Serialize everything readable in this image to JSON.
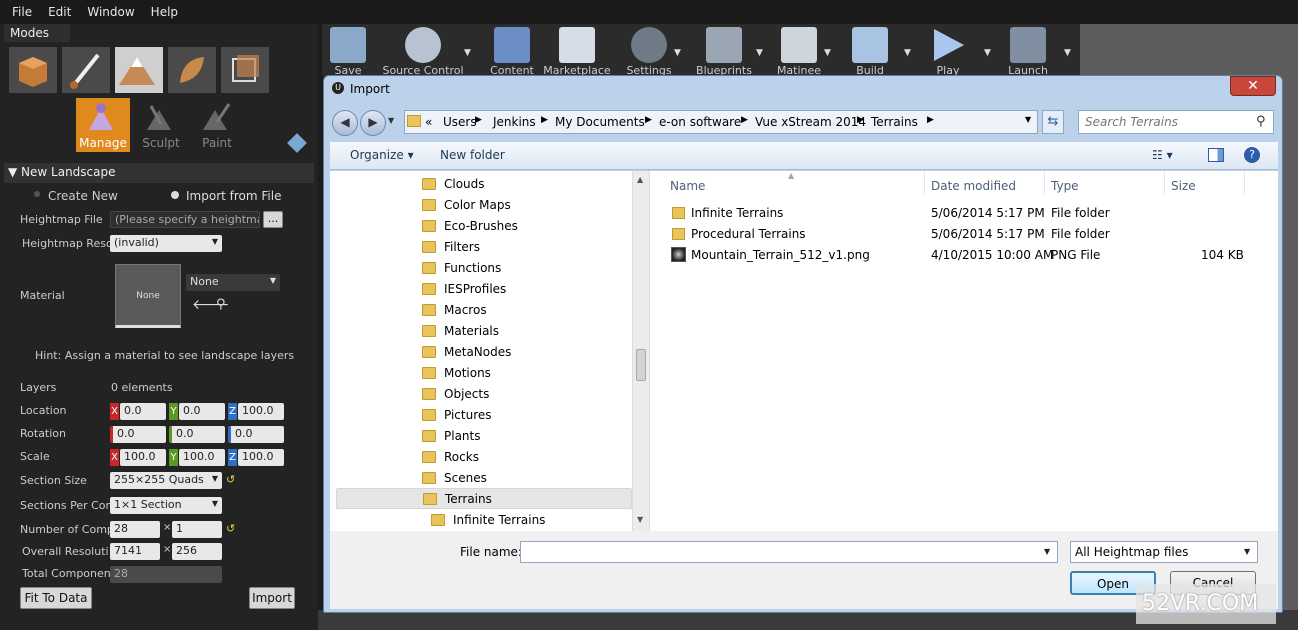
{
  "menu": [
    "File",
    "Edit",
    "Window",
    "Help"
  ],
  "modes": {
    "tab": "Modes",
    "tools": [
      {
        "label": "Manage",
        "active": true
      },
      {
        "label": "Sculpt",
        "active": false
      },
      {
        "label": "Paint",
        "active": false
      }
    ]
  },
  "landscape": {
    "section_title": "New Landscape",
    "create_new": "Create New",
    "import_from_file": "Import from File",
    "heightmap_file_label": "Heightmap File",
    "heightmap_file_placeholder": "(Please specify a heightmap",
    "browse": "...",
    "heightmap_res_label": "Heightmap Reso",
    "heightmap_res_value": "(invalid)",
    "material_label": "Material",
    "material_thumb": "None",
    "material_value": "None",
    "hint": "Hint: Assign a material to see landscape layers",
    "layers_label": "Layers",
    "layers_value": "0 elements",
    "location_label": "Location",
    "location": [
      "0.0",
      "0.0",
      "100.0"
    ],
    "rotation_label": "Rotation",
    "rotation": [
      "0.0",
      "0.0",
      "0.0"
    ],
    "scale_label": "Scale",
    "scale": [
      "100.0",
      "100.0",
      "100.0"
    ],
    "axes": [
      "X",
      "Y",
      "Z"
    ],
    "section_size_label": "Section Size",
    "section_size_value": "255×255 Quads",
    "sections_per_label": "Sections Per Com",
    "sections_per_value": "1×1 Section",
    "num_comp_label": "Number of Comp",
    "num_comp": [
      "28",
      "1"
    ],
    "overall_res_label": "Overall Resoluti",
    "overall_res": [
      "7141",
      "256"
    ],
    "total_comp_label": "Total Componen",
    "total_comp_value": "28",
    "times": "×",
    "fit_to_data": "Fit To Data",
    "import": "Import"
  },
  "toolbar": [
    "Save",
    "Source Control",
    "Content",
    "Marketplace",
    "Settings",
    "Blueprints",
    "Matinee",
    "Build",
    "Play",
    "Launch"
  ],
  "dialog": {
    "title": "Import",
    "close": "✕",
    "breadcrumb": [
      "«",
      "Users",
      "Jenkins",
      "My Documents",
      "e-on software",
      "Vue xStream 2014",
      "Terrains"
    ],
    "search_placeholder": "Search Terrains",
    "organize": "Organize",
    "new_folder": "New folder",
    "nav_items": [
      "Clouds",
      "Color Maps",
      "Eco-Brushes",
      "Filters",
      "Functions",
      "IESProfiles",
      "Macros",
      "Materials",
      "MetaNodes",
      "Motions",
      "Objects",
      "Pictures",
      "Plants",
      "Rocks",
      "Scenes",
      "Terrains",
      "Infinite Terrains"
    ],
    "selected_nav": "Terrains",
    "columns": [
      "Name",
      "Date modified",
      "Type",
      "Size"
    ],
    "files": [
      {
        "name": "Infinite Terrains",
        "date": "5/06/2014 5:17 PM",
        "type": "File folder",
        "size": "",
        "kind": "folder"
      },
      {
        "name": "Procedural Terrains",
        "date": "5/06/2014 5:17 PM",
        "type": "File folder",
        "size": "",
        "kind": "folder"
      },
      {
        "name": "Mountain_Terrain_512_v1.png",
        "date": "4/10/2015 10:00 AM",
        "type": "PNG File",
        "size": "104 KB",
        "kind": "png"
      }
    ],
    "file_name_label": "File name:",
    "file_name_value": "",
    "file_type": "All Heightmap files",
    "open": "Open",
    "cancel": "Cancel"
  },
  "watermark": "52VR.COM"
}
